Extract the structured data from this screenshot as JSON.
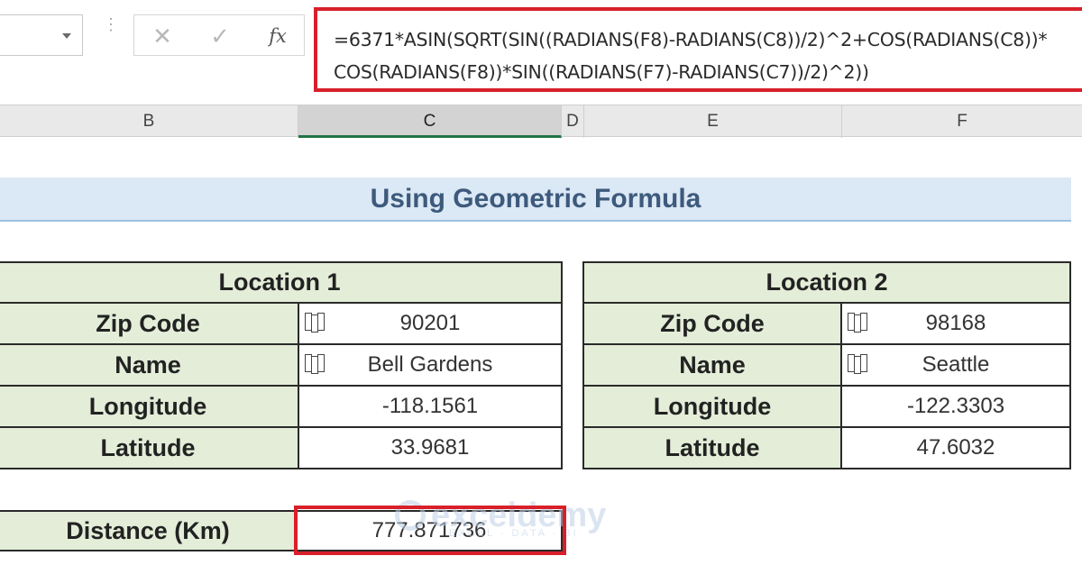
{
  "formula_bar": {
    "formula_line1": "=6371*ASIN(SQRT(SIN((RADIANS(F8)-RADIANS(C8))/2)^2+COS(RADIANS(C8))*",
    "formula_line2": "COS(RADIANS(F8))*SIN((RADIANS(F7)-RADIANS(C7))/2)^2))",
    "cancel_icon": "✕",
    "enter_icon": "✓",
    "fx_label": "fx"
  },
  "columns": [
    "B",
    "C",
    "D",
    "E",
    "F"
  ],
  "title": "Using Geometric Formula",
  "location1": {
    "header": "Location 1",
    "rows": [
      {
        "label": "Zip Code",
        "value": "90201",
        "icon": "map-icon"
      },
      {
        "label": "Name",
        "value": "Bell Gardens",
        "icon": "map-icon"
      },
      {
        "label": "Longitude",
        "value": "-118.1561"
      },
      {
        "label": "Latitude",
        "value": "33.9681"
      }
    ]
  },
  "location2": {
    "header": "Location 2",
    "rows": [
      {
        "label": "Zip Code",
        "value": "98168",
        "icon": "map-icon"
      },
      {
        "label": "Name",
        "value": "Seattle",
        "icon": "map-icon"
      },
      {
        "label": "Longitude",
        "value": "-122.3303"
      },
      {
        "label": "Latitude",
        "value": "47.6032"
      }
    ]
  },
  "distance": {
    "label": "Distance (Km)",
    "value": "777.871736"
  },
  "watermark": {
    "text": "exceldemy",
    "sub": "EXCEL · DATA · BI"
  },
  "colors": {
    "highlight_red": "#d8202a",
    "label_fill": "#e3edd8",
    "title_fill": "#dbe8f5",
    "title_text": "#3d5a7c"
  }
}
